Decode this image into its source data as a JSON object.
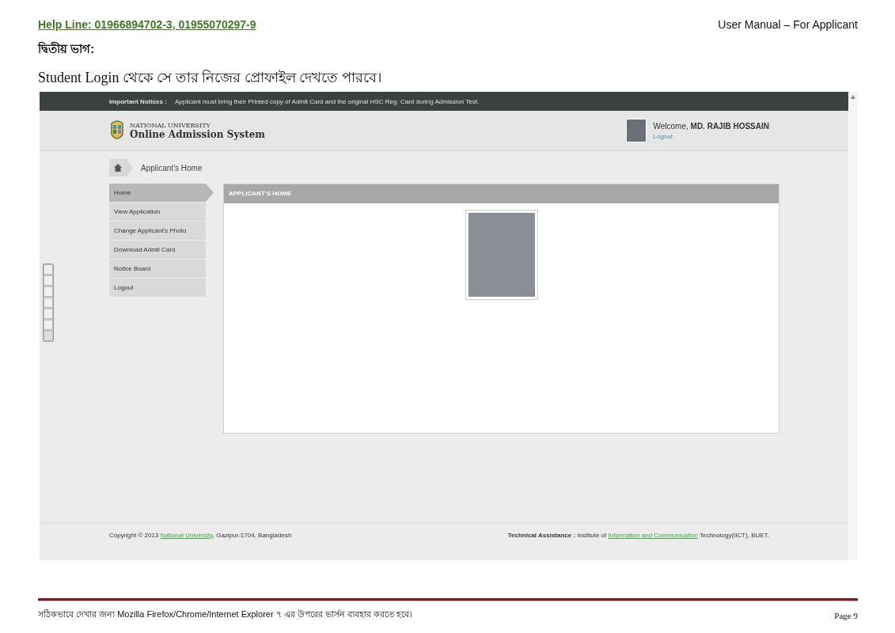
{
  "page_header": {
    "help_line": "Help Line: 01966894702-3, 01955070297-9",
    "manual_title": "User Manual – For Applicant"
  },
  "section_heading": "দ্বিতীয় ভাগ:",
  "intro": "Student Login থেকে সে তার নিজের প্রোফাইল দেখতে পারবে।",
  "screenshot": {
    "notice": {
      "label": "Important Notices :",
      "text": "Applicant must bring their Printed copy of Admit Card and the original HSC Reg. Card during Admission Test."
    },
    "logo": {
      "line1": "NATIONAL UNIVERSITY",
      "line2": "Online Admission System"
    },
    "user": {
      "welcome": "Welcome, **MD. RAJIB HOSSAIN**",
      "logout": "Logout"
    },
    "breadcrumb": "Applicant's Home",
    "menu": [
      {
        "label": "Home",
        "selected": true
      },
      {
        "label": "View Application",
        "selected": false
      },
      {
        "label": "Change Applicant's Photo",
        "selected": false
      },
      {
        "label": "Download Admit Card",
        "selected": false
      },
      {
        "label": "Notice Board",
        "selected": false
      },
      {
        "label": "Logout",
        "selected": false
      }
    ],
    "panel_title": "APPLICANT'S HOME",
    "footer": {
      "copyright_before": "Copyright © 2013",
      "copyright_link": "National University",
      "copyright_after": ", Gazipur-1704, Bangladesh",
      "tech_label": "Technical Assistance :",
      "tech_before": "Institute of",
      "tech_link": "Information and Communication",
      "tech_after": "Technology(IICT), BUET."
    }
  },
  "page_footer": {
    "note": "সঠিকভাবে দেখার জন্য  Mozilla Firefox/Chrome/Internet Explorer ৭ এর উপরের ভার্সন ব্যবহার করতে হবে।",
    "page": "Page 9"
  }
}
